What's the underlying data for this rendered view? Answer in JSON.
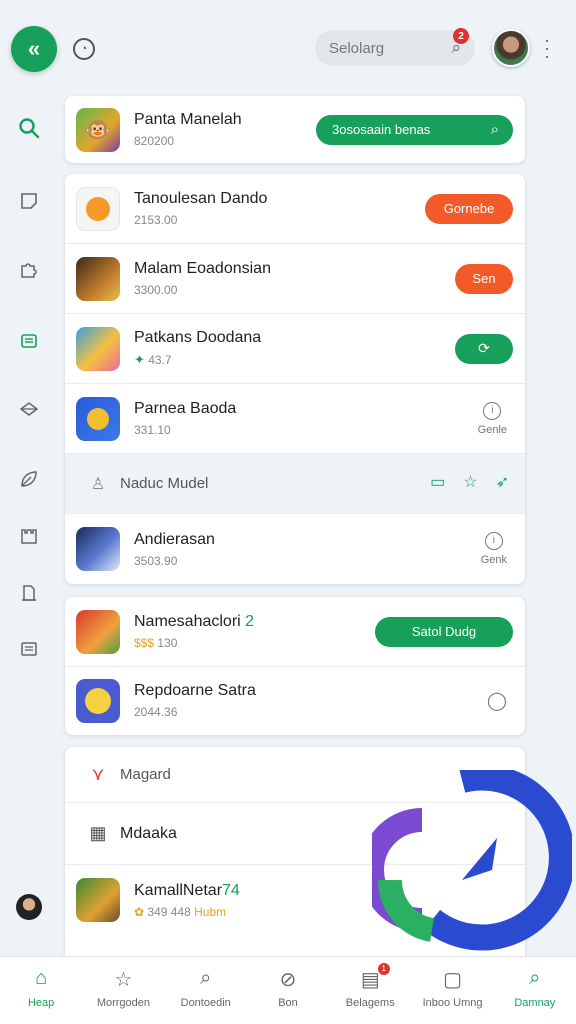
{
  "colors": {
    "accent": "#16a05a",
    "warning": "#f25a2a",
    "badge": "#e03030"
  },
  "topbar": {
    "search_placeholder": "Selolarg",
    "search_badge": "2"
  },
  "rail": {
    "icons": [
      "search-icon",
      "note-icon",
      "puzzle-icon",
      "shopping-bag-icon",
      "diamond-icon",
      "leaf-icon",
      "castle-icon",
      "document-icon",
      "list-icon"
    ]
  },
  "card1": {
    "app": {
      "name": "Panta Manelah",
      "sub": "820200",
      "action": "3ososaain benas"
    }
  },
  "card2": {
    "apps": [
      {
        "name": "Tanoulesan Dando",
        "sub": "2153.00",
        "action": "Gornebe",
        "style": "orange"
      },
      {
        "name": "Malam Eoadonsian",
        "sub": "3300.00",
        "action": "Sen",
        "style": "orange"
      },
      {
        "name": "Patkans Doodana",
        "sub": "43.7",
        "action": "",
        "style": "green"
      },
      {
        "name": "Parnea Baoda",
        "sub": "331.10",
        "action": "Genle",
        "style": "side"
      }
    ],
    "subheader": "Naduc Mudel",
    "last_app": {
      "name": "Andierasan",
      "sub": "3503.90",
      "action": "Genk"
    }
  },
  "card3": {
    "apps": [
      {
        "name": "Namesahaclori",
        "badge": "2",
        "sub": "130",
        "action": "Satol Dudg"
      },
      {
        "name": "Repdoarne Satra",
        "sub": "2044.36"
      }
    ]
  },
  "card4": {
    "rows": [
      {
        "label": "Magard"
      },
      {
        "label": "Mdaaka"
      }
    ],
    "app": {
      "name": "KamallNetar",
      "badge": "74",
      "sub_prefix": "349 448",
      "sub_suffix": "Hubm"
    }
  },
  "bottomnav": [
    {
      "label": "Heap",
      "icon": "home-icon",
      "active": true
    },
    {
      "label": "Morrgoden",
      "icon": "star-icon",
      "active": false
    },
    {
      "label": "Dontoedin",
      "icon": "search-icon",
      "active": false
    },
    {
      "label": "Bon",
      "icon": "compass-icon",
      "active": false
    },
    {
      "label": "Belagems",
      "icon": "inbox-icon",
      "active": false,
      "badge": "1"
    },
    {
      "label": "Inboo Umng",
      "icon": "folder-icon",
      "active": false
    },
    {
      "label": "Damnay",
      "icon": "search-icon",
      "active": false
    }
  ]
}
